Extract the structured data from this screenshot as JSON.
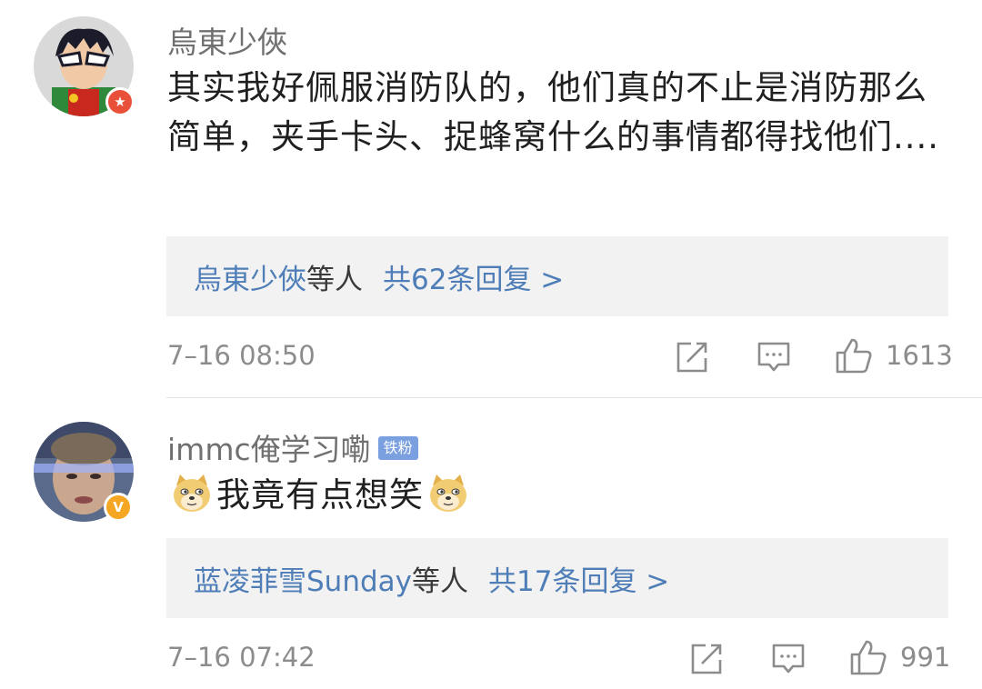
{
  "comments": [
    {
      "username": "烏東少俠",
      "badge_icon": "star-badge-icon",
      "text": "其实我好佩服消防队的，他们真的不止是消防那么简单，夹手卡头、捉蜂窝什么的事情都得找他们....",
      "reply_names": "烏東少俠",
      "reply_suffix": "等人",
      "reply_count": "共62条回复 >",
      "timestamp": "7–16 08:50",
      "likes": "1613"
    },
    {
      "username": "immc俺学习嘞",
      "fan_badge": "铁粉",
      "badge_icon": "verified-v-icon",
      "text": "我竟有点想笑",
      "reply_names": "蓝凌菲雪Sunday",
      "reply_suffix": "等人",
      "reply_count": "共17条回复 >",
      "timestamp": "7–16 07:42",
      "likes": "991"
    }
  ],
  "colors": {
    "link_blue": "#4e7db7",
    "reply_bg": "#f2f2f2",
    "meta_gray": "#8c8c8c",
    "badge_red": "#e8503a",
    "badge_orange": "#f5a623",
    "fan_badge_blue": "#7ba0e0"
  },
  "icons": [
    "share-icon",
    "comment-icon",
    "like-thumb-icon",
    "doge-emoji-icon"
  ]
}
